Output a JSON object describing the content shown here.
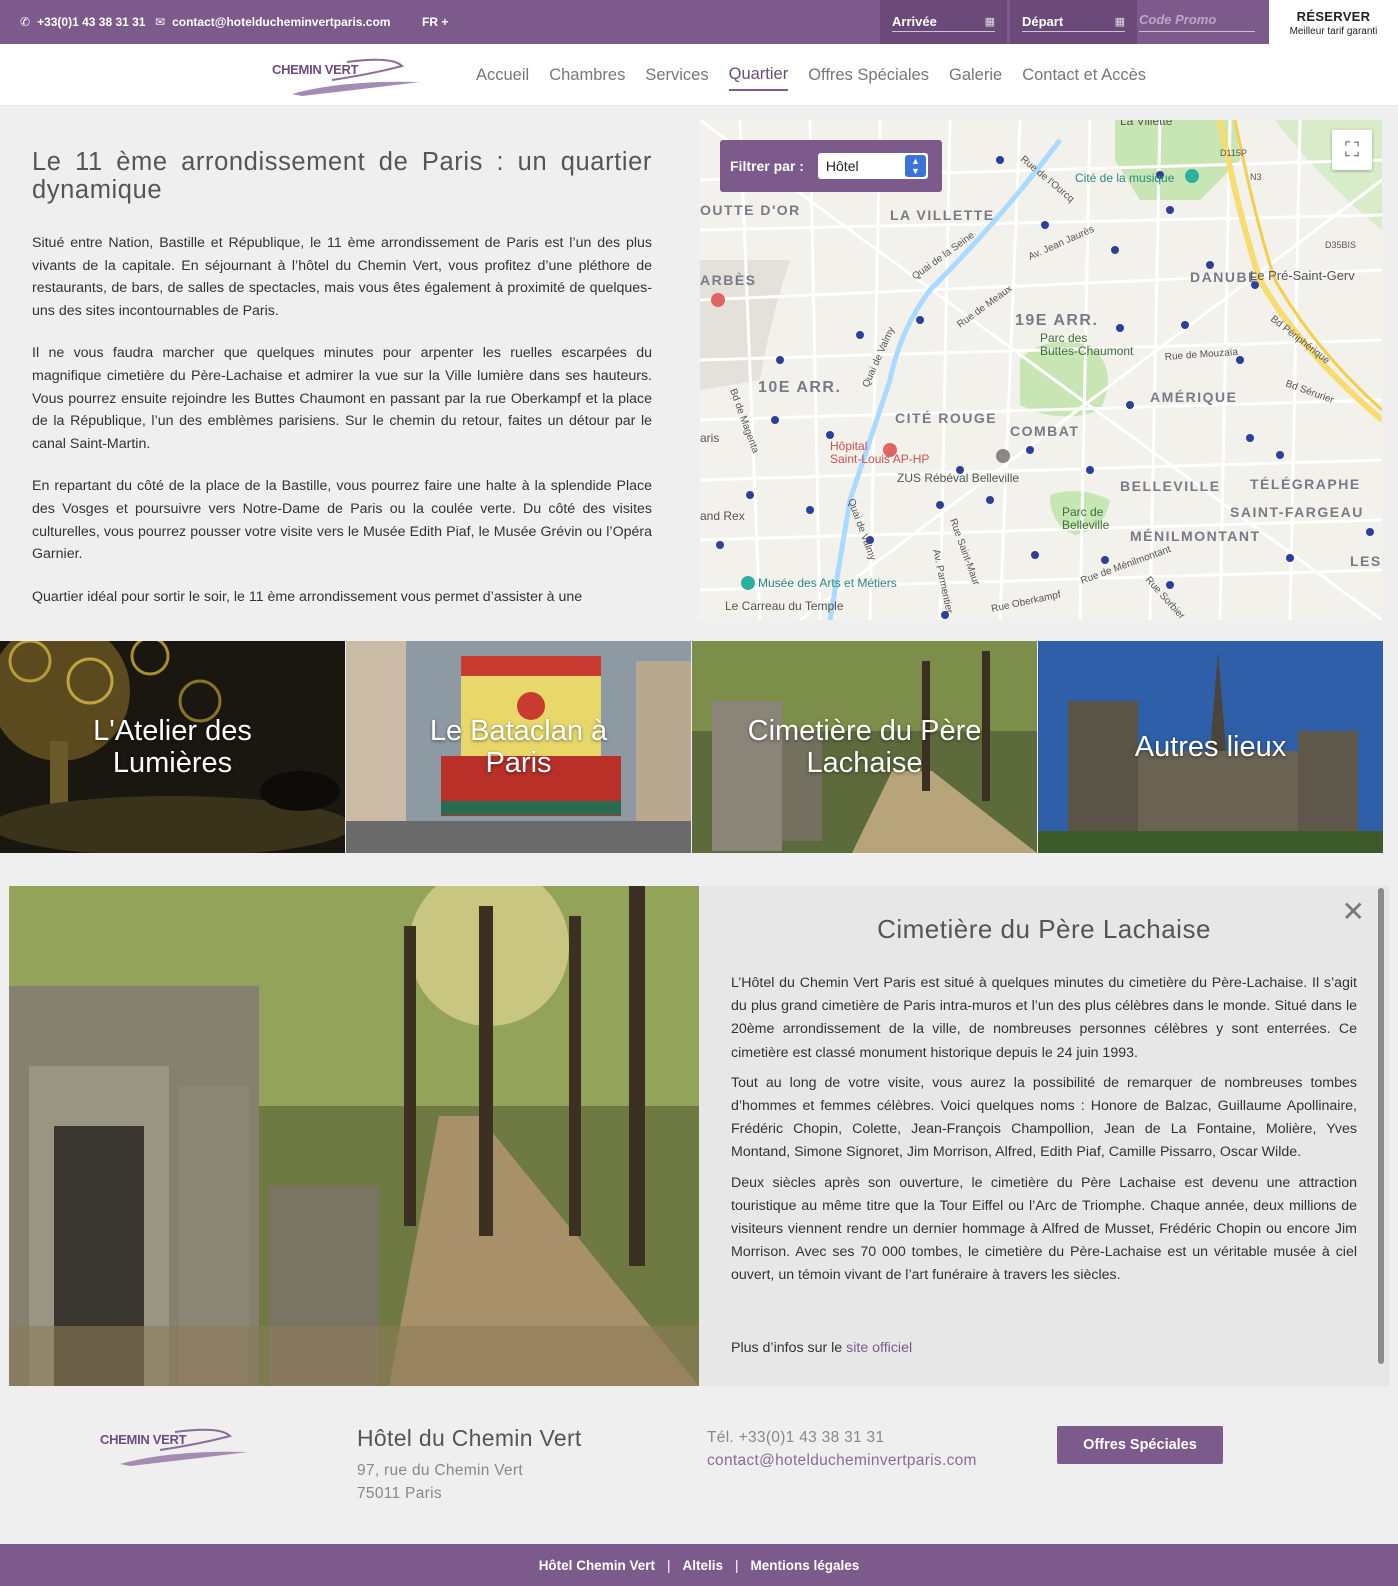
{
  "topbar": {
    "phone": "+33(0)1 43 38 31 31",
    "email": "contact@hotelducheminvertparis.com",
    "lang": "FR +",
    "arrival_placeholder": "Arrivée",
    "departure_placeholder": "Départ",
    "promo_placeholder": "Code Promo",
    "reserve_label": "RÉSERVER",
    "reserve_sub": "Meilleur tarif garanti",
    "phone_icon": "phone-icon",
    "email_icon": "envelope-icon",
    "calendar_icon": "calendar-icon"
  },
  "nav": {
    "logo_text": "CHEMIN VERT",
    "items": [
      "Accueil",
      "Chambres",
      "Services",
      "Quartier",
      "Offres Spéciales",
      "Galerie",
      "Contact et Accès"
    ],
    "active": "Quartier"
  },
  "article": {
    "title": "Le 11 ème arrondissement de Paris : un quartier dynamique",
    "paragraphs": [
      "Situé entre Nation, Bastille et République, le 11 ème arrondissement de Paris est l’un des plus vivants de la capitale. En séjournant à l’hôtel du Chemin Vert, vous profitez d’une pléthore de restaurants, de bars, de salles de spectacles, mais vous êtes également à proximité de quelques-uns des sites incontournables de Paris.",
      "Il ne vous faudra marcher que quelques minutes pour arpenter les ruelles escarpées du magnifique cimetière du Père-Lachaise et admirer la vue sur la Ville lumière dans ses hauteurs. Vous pourrez ensuite rejoindre les Buttes Chaumont en passant par la rue Oberkampf et la place de la République, l’un des emblèmes parisiens. Sur le chemin du retour, faites un détour par le canal Saint-Martin.",
      "En repartant du côté de la place de la Bastille, vous pourrez faire une halte à la splendide Place des Vosges et poursuivre vers Notre-Dame de Paris ou la coulée verte. Du côté des visites culturelles, vous pourrez pousser votre visite vers le Musée Edith Piaf, le Musée Grévin ou l’Opéra Garnier.",
      "Quartier idéal pour sortir le soir, le 11 ème arrondissement vous permet d’assister à une"
    ]
  },
  "map": {
    "filter_label": "Filtrer par :",
    "filter_value": "Hôtel",
    "fullscreen_icon": "fullscreen-icon",
    "labels": {
      "villette": "LA VILLETTE",
      "goutte": "OUTTE D'OR",
      "barbes": "ARBÈS",
      "danube": "DANUBE",
      "pre": "Le Pré-Saint-Gerv",
      "arr19": "19E ARR.",
      "arr10": "10E ARR.",
      "amerique": "AMÉRIQUE",
      "cite_rouge": "CITÉ ROUGE",
      "combat": "COMBAT",
      "belleville": "BELLEVILLE",
      "telegraphe": "TÉLÉGRAPHE",
      "fargeau": "SAINT-FARGEAU",
      "menilmontant": "MÉNILMONTANT",
      "lesp": "LES P",
      "cite_musique": "Cité de la musique",
      "buttes": "Parc des\nButtes-Chaumont",
      "parc_belleville": "Parc de\nBelleville",
      "hopital": "Hôpital\nSaint-Louis AP-HP",
      "zus": "ZUS Rébéval Belleville",
      "musee": "Musée des Arts et Métiers",
      "carreau": "Le Carreau du Temple",
      "grandrex": "and Rex",
      "paris": "aris",
      "la_villette_top": "La Villette",
      "d115p": "D115P",
      "n3": "N3",
      "d35bis": "D35BIS",
      "rue_ourcq": "Rue de l'Ourcq",
      "quai_seine": "Quai de la Seine",
      "jean_jaures": "Av. Jean Jaurès",
      "rue_meaux": "Rue de Meaux",
      "quai_valmy": "Quai de Valmy",
      "bd_magenta": "Bd de Magenta",
      "rue_mouzaia": "Rue de Mouzaïa",
      "bd_peripherique": "Bd Périphérique",
      "bd_serurier": "Bd Sérurier",
      "quai_valmy2": "Quai de Valmy",
      "av_parmentier": "Av. Parmentier",
      "rue_st_maur": "Rue Saint-Maur",
      "rue_menilmontant": "Rue de Ménilmontant",
      "rue_sorbier": "Rue Sorbier",
      "rue_oberkampf": "Rue Oberkampf"
    }
  },
  "tiles": [
    {
      "title": "L'Atelier des Lumières"
    },
    {
      "title": "Le Bataclan à Paris"
    },
    {
      "title": "Cimetière du Père Lachaise"
    },
    {
      "title": "Autres lieux"
    }
  ],
  "detail": {
    "title": "Cimetière du Père Lachaise",
    "close_icon": "close-icon",
    "paragraphs": [
      "L’Hôtel du Chemin Vert Paris est situé à quelques minutes du cimetière du Père-Lachaise. Il s’agit du plus grand cimetière de Paris intra-muros et l’un des plus célèbres dans le monde. Situé dans le 20ème arrondissement de la ville, de nombreuses personnes célèbres y sont enterrées. Ce cimetière est classé monument historique depuis le 24 juin 1993.",
      "Tout au long de votre visite, vous aurez la possibilité de remarquer de nombreuses tombes d’hommes et femmes célèbres. Voici quelques noms : Honore de Balzac, Guillaume Apollinaire, Frédéric Chopin, Colette, Jean-François Champollion, Jean de La Fontaine, Molière, Yves Montand, Simone Signoret, Jim Morrison, Alfred, Edith Piaf, Camille Pissarro, Oscar Wilde.",
      "Deux siècles après son ouverture, le cimetière du Père Lachaise est devenu une attraction touristique au même titre que la Tour Eiffel ou l’Arc de Triomphe. Chaque année, deux millions de visiteurs viennent rendre un dernier hommage à Alfred de Musset, Frédéric Chopin ou encore Jim Morrison. Avec ses 70 000 tombes, le cimetière du Père-Lachaise est un véritable musée à ciel ouvert, un témoin vivant de l’art funéraire à travers les siècles."
    ],
    "more_prefix": "Plus d’infos sur le ",
    "more_link": "site officiel"
  },
  "footer": {
    "logo_text": "CHEMIN VERT",
    "hotel_name": "Hôtel du Chemin Vert",
    "address_line1": "97, rue du Chemin Vert",
    "address_line2": "75011 Paris",
    "phone": "Tél. +33(0)1 43 38 31 31",
    "email": "contact@hotelducheminvertparis.com",
    "offers_button": "Offres Spéciales",
    "links": [
      "Hôtel Chemin Vert",
      "Altelis",
      "Mentions légales"
    ]
  },
  "colors": {
    "brand_purple": "#7d5a8c",
    "dark_purple": "#6b4a7a",
    "map_green": "#c8e6b4",
    "map_water": "#aadaff"
  }
}
